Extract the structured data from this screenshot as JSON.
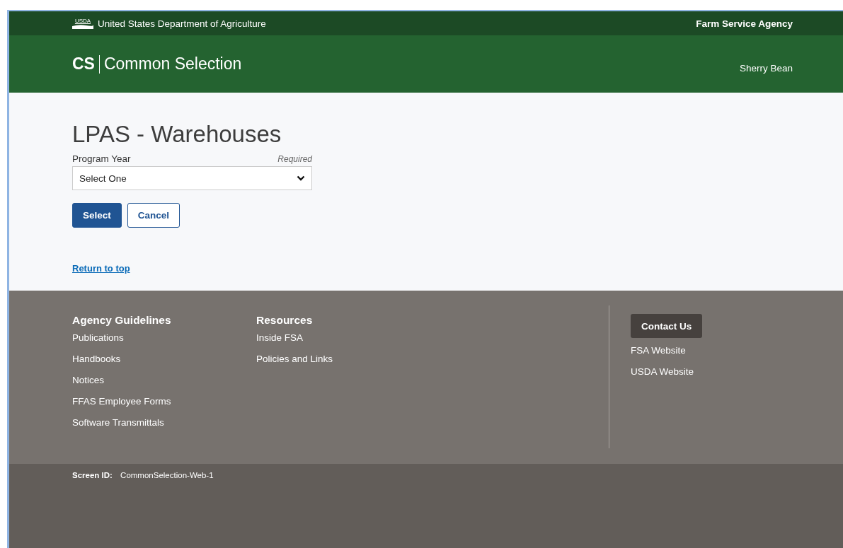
{
  "top_bar": {
    "logo_text": "USDA",
    "department": "United States Department of Agriculture",
    "agency": "Farm Service Agency"
  },
  "header": {
    "app_code": "CS",
    "app_name": "Common Selection",
    "user": "Sherry Bean"
  },
  "page": {
    "title": "LPAS - Warehouses",
    "field": {
      "label": "Program Year",
      "required_note": "Required",
      "value": "Select One"
    },
    "buttons": [
      {
        "label": "Select",
        "kind": "primary"
      },
      {
        "label": "Cancel",
        "kind": "secondary"
      }
    ],
    "return_link": "Return to top"
  },
  "footer": {
    "columns": [
      {
        "heading": "Agency Guidelines",
        "links": [
          "Publications",
          "Handbooks",
          "Notices",
          "FFAS Employee Forms",
          "Software Transmittals"
        ]
      },
      {
        "heading": "Resources",
        "links": [
          "Inside FSA",
          "Policies and Links"
        ]
      }
    ],
    "contact": {
      "button": "Contact Us",
      "links": [
        "FSA Website",
        "USDA Website"
      ]
    }
  },
  "bottom_bar": {
    "label": "Screen ID:",
    "value": "CommonSelection-Web-1"
  }
}
